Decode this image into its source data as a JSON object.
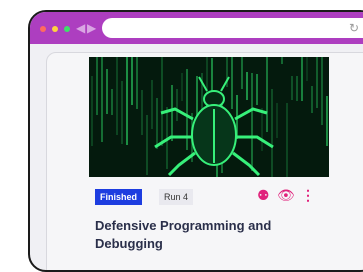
{
  "colors": {
    "chrome": "#ad3ec0",
    "finished_badge": "#1d3de0",
    "action_icons": "#e0237c",
    "matrix_green": "#2ee06a"
  },
  "icons": {
    "back": "◀",
    "forward": "▶",
    "reload": "↻",
    "bookmark": "★",
    "pin": "⚉",
    "view": "👁",
    "more": "⋮"
  },
  "card": {
    "status": "Finished",
    "run": "Run 4",
    "title": "Defensive Programming and Debugging"
  }
}
